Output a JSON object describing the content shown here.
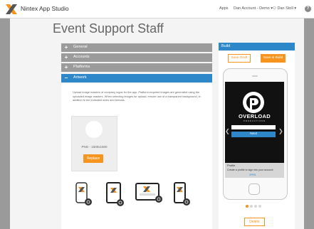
{
  "header": {
    "app_title": "Nintex App Studio",
    "nav": {
      "apps": "Apps",
      "account": "Dan Account - Demo ▾",
      "user": "Dan Stoll ▾"
    },
    "help_icon": "question-circle-icon"
  },
  "page_title": "Event Support Staff",
  "accordion": [
    {
      "label": "General",
      "icon": "+"
    },
    {
      "label": "Accounts",
      "icon": "+"
    },
    {
      "label": "Platforms",
      "icon": "+"
    },
    {
      "label": "Artwork",
      "icon": "–"
    }
  ],
  "artwork": {
    "description": "Upload image masters of company logos for the app. Platform-required images are generated using the uploaded image masters. When selecting images for upload, ensure use of a transparent background, in addition to the indicated sizes and formats.",
    "image_format": "PNG - 1500x1500",
    "replace_label": "Replace"
  },
  "build": {
    "title": "Build",
    "save_draft_label": "Save Draft",
    "save_build_label": "Save & Build",
    "preview": {
      "brand_name": "OVERLOAD",
      "brand_sub": "PRODUCTIONS",
      "next_label": "Next",
      "profile_title": "Profile",
      "profile_desc": "Create a profile to sign into your account",
      "profile_link": "OPEN"
    },
    "delete_label": "Delete"
  },
  "colors": {
    "accent": "#2d87c9",
    "orange": "#f7941d",
    "collapsed": "#9b9b9b"
  }
}
